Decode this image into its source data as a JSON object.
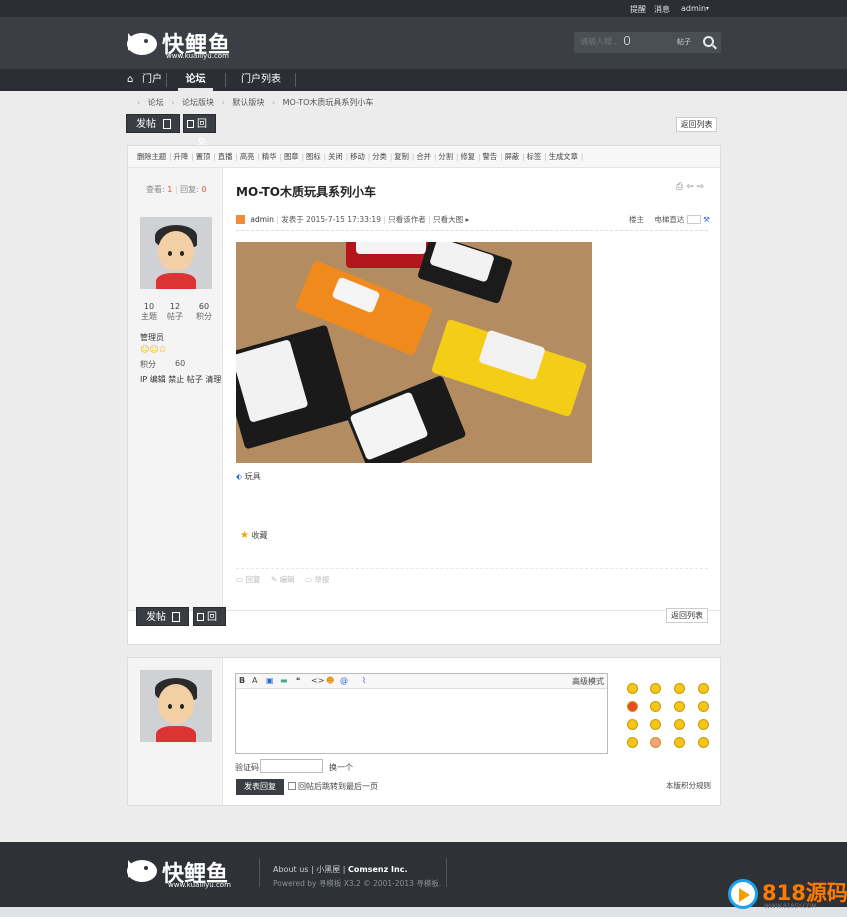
{
  "topbar": {
    "remind": "提醒",
    "messages": "消息",
    "user": "admin"
  },
  "brand": {
    "name": "快鲤鱼",
    "url": "www.kuailiyu.com"
  },
  "search": {
    "placeholder": "请输入搜...",
    "type": "帖子"
  },
  "nav": {
    "items": [
      {
        "label": "门户"
      },
      {
        "label": "论坛"
      },
      {
        "label": "门户列表"
      }
    ]
  },
  "breadcrumb": [
    "论坛",
    "论坛版块",
    "默认版块",
    "MO-TO木质玩具系列小车"
  ],
  "buttons": {
    "new_post": "发帖",
    "reply": "回复",
    "back_list": "返回列表"
  },
  "moderation": [
    "删除主题",
    "升降",
    "置顶",
    "直播",
    "高亮",
    "精华",
    "图章",
    "图标",
    "关闭",
    "移动",
    "分类",
    "复制",
    "合并",
    "分割",
    "修复",
    "警告",
    "屏蔽",
    "标签",
    "生成文章"
  ],
  "stats": {
    "views_label": "查看:",
    "views": "1",
    "replies_label": "回复:",
    "replies": "0"
  },
  "author": {
    "threads": "10",
    "threads_label": "主题",
    "posts": "12",
    "posts_label": "帖子",
    "credits": "60",
    "credits_label": "积分",
    "group": "管理员",
    "credits_row_label": "积分",
    "credits_row": "60",
    "admin_links": "IP 编辑 禁止 帖子 清理"
  },
  "post": {
    "title": "MO-TO木质玩具系列小车",
    "author": "admin",
    "published": "发表于 2015-7-15 17:33:19",
    "only_author": "只看该作者",
    "only_big": "只看大图",
    "floor_owner": "楼主",
    "elevator": "电梯直达",
    "tag": "玩具",
    "favorite": "收藏",
    "action_reply": "回复",
    "action_edit": "编辑",
    "action_report": "举报"
  },
  "editor": {
    "advanced": "高级模式"
  },
  "reply_form": {
    "captcha_label": "验证码",
    "captcha_switch": "换一个",
    "submit": "发表回复",
    "jump_label": "回帖后跳转到最后一页",
    "rules": "本版积分规则"
  },
  "footer": {
    "about": "About us",
    "site": "小黑屋",
    "company": "Comsenz Inc.",
    "powered": "Powered by 寻模板 X3.2 © 2001-2013 寻模板."
  },
  "badge": {
    "text": "818源码",
    "sub": "WWW.818SY.COM"
  },
  "colors": {
    "header_bg": "#3b3f45",
    "topbar_bg": "#2b2f34",
    "accent_orange": "#e4563c",
    "button_dark": "#3a3d42"
  }
}
